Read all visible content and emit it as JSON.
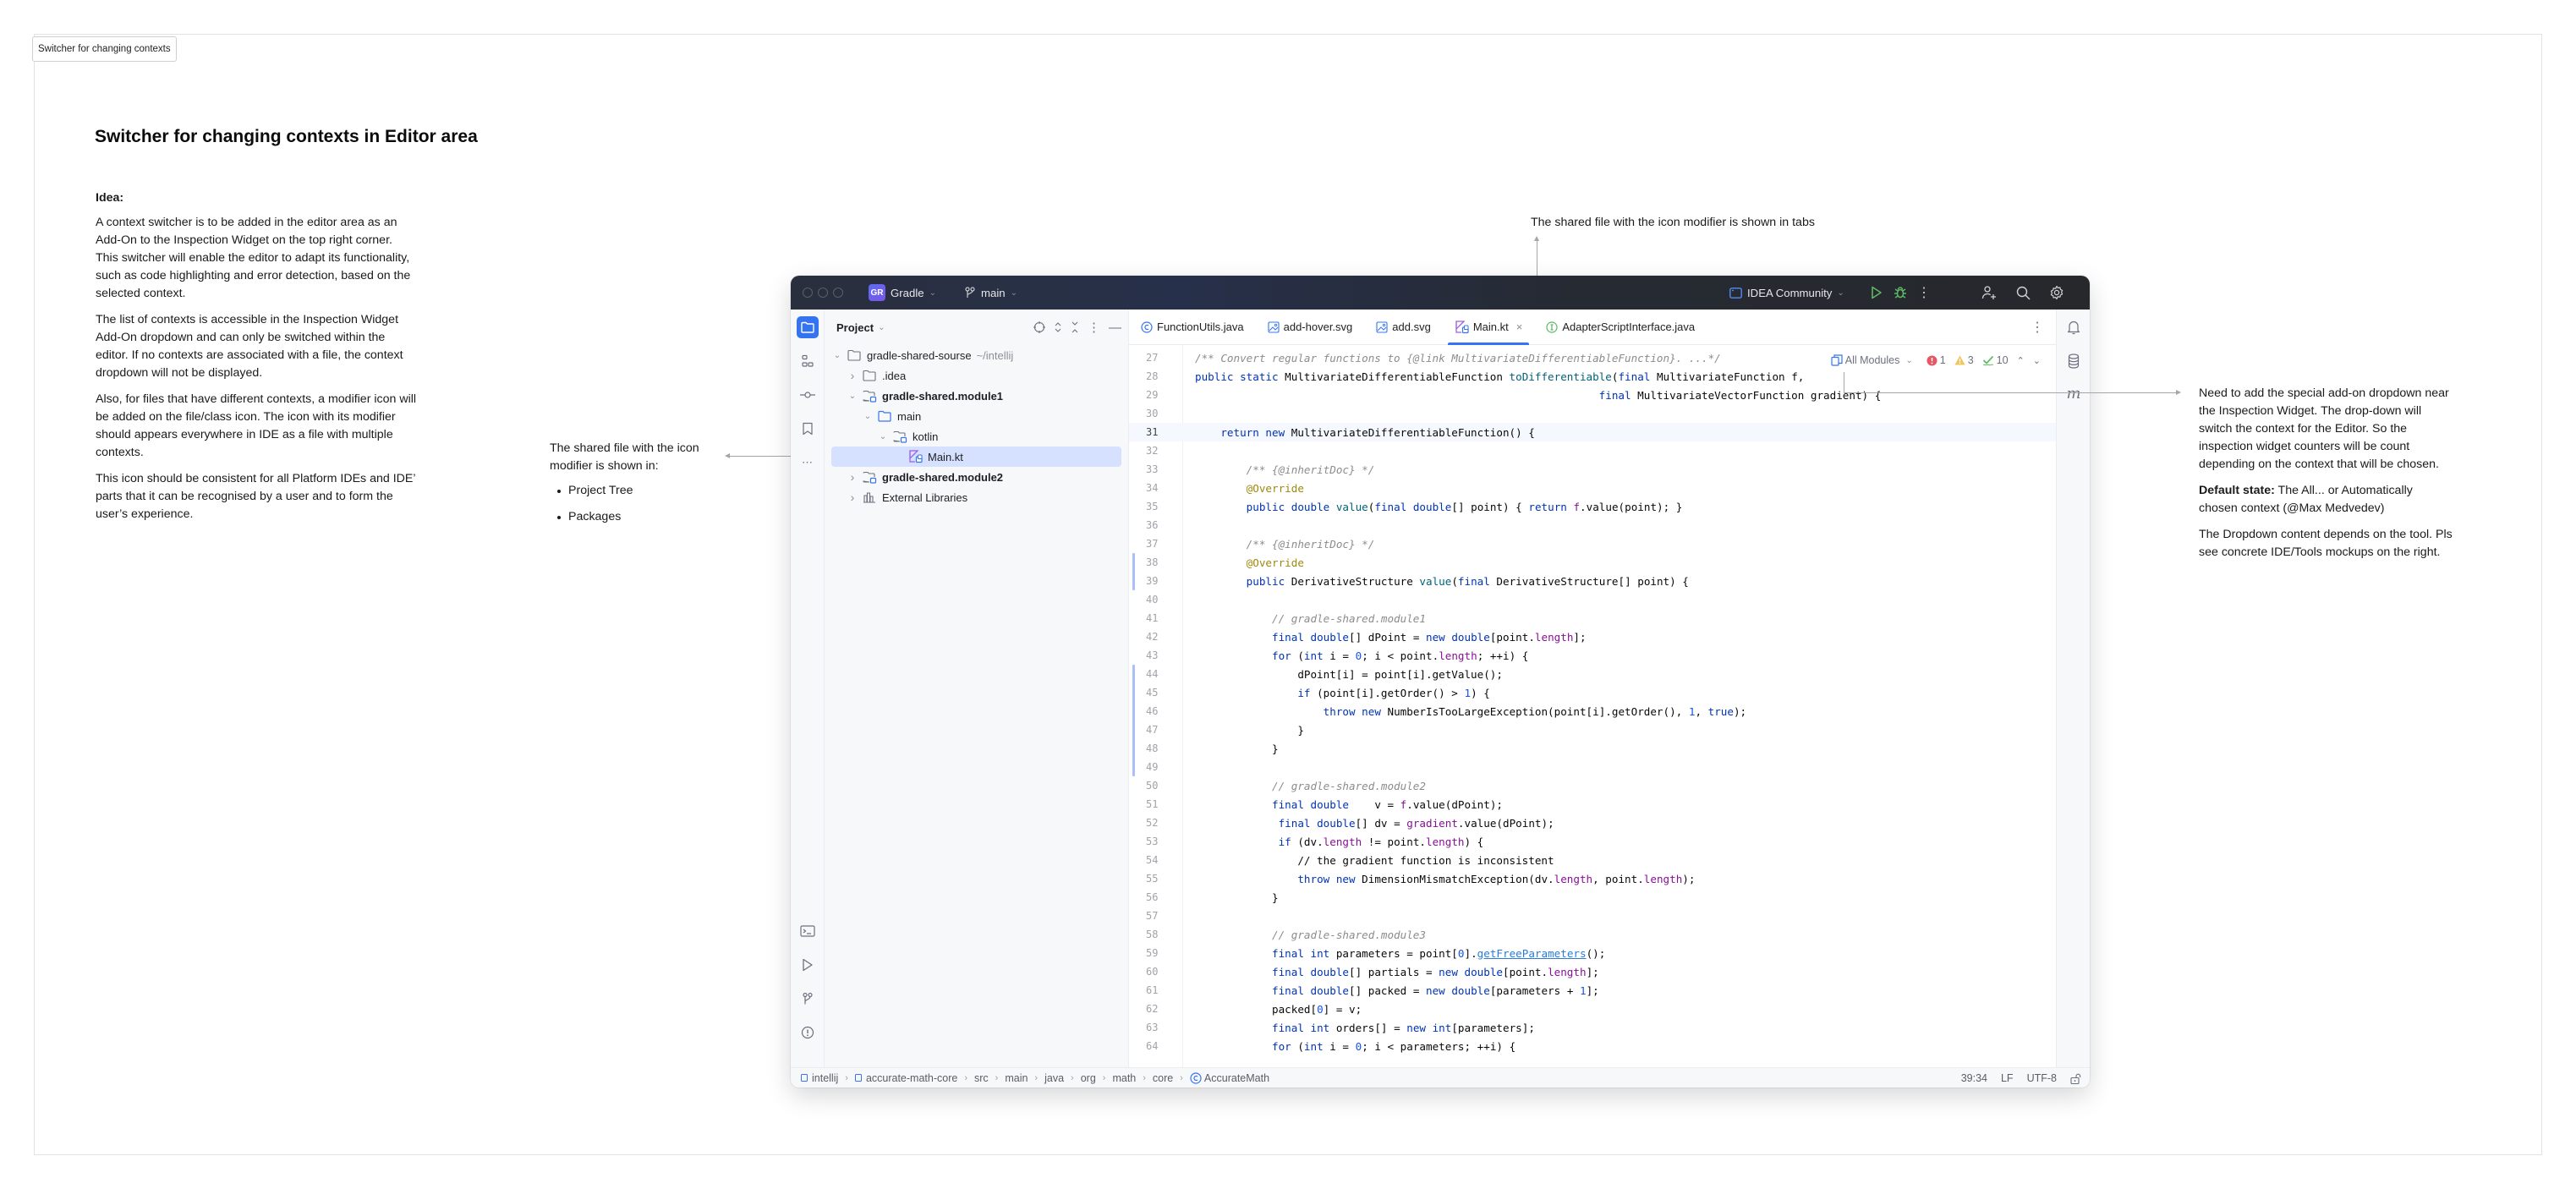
{
  "frame": {
    "label": "Switcher for changing contexts"
  },
  "page": {
    "title": "Switcher for changing contexts in Editor area"
  },
  "idea": {
    "heading": "Idea:",
    "paragraphs": [
      "A context switcher is to be added in the editor area as an Add-On to the Inspection Widget on the top right corner. This switcher will enable the editor to adapt its functionality, such as code highlighting and error detection, based on the selected context.",
      "The list of contexts is accessible in the Inspection Widget Add-On dropdown and can only be switched within the editor. If no contexts are associated with a file, the context dropdown will not be displayed.",
      "Also, for files that have different contexts, a modifier icon will be added on the file/class icon. The icon with its modifier should appears everywhere in IDE as a file with multiple contexts.",
      "This icon should be consistent for all Platform IDEs and IDE’ parts that it can be recognised by a user and to form the user’s experience."
    ]
  },
  "annotations": {
    "tree_note": {
      "text": "The shared file with the icon modifier is shown in:",
      "items": [
        "Project Tree",
        "Packages"
      ]
    },
    "tabs_note": "The shared file with the icon modifier is shown in tabs",
    "right_note": {
      "p1": "Need to add the special add-on dropdown near the Inspection Widget. The drop-down will switch the context for the Editor. So the inspection widget counters will be count depending on the context that will be chosen.",
      "default_label": "Default state:",
      "default_text": " The All...  or Automatically chosen context (@Max Medvedev)",
      "p3": "The Dropdown content depends on the tool. Pls see concrete IDE/Tools mockups on the right."
    }
  },
  "ide": {
    "titlebar": {
      "project_badge": "GR",
      "project_name": "Gradle",
      "branch": "main",
      "run_config": "IDEA Community"
    },
    "project_panel": {
      "title": "Project",
      "tree": [
        {
          "label": "gradle-shared-sourse",
          "suffix": "~/intellij",
          "level": 0,
          "expanded": true,
          "icon": "folder-icon",
          "bold": false
        },
        {
          "label": ".idea",
          "level": 1,
          "expanded": false,
          "icon": "folder-icon",
          "bold": false
        },
        {
          "label": "gradle-shared.module1",
          "level": 1,
          "expanded": true,
          "icon": "module-folder-icon",
          "bold": true
        },
        {
          "label": "main",
          "level": 2,
          "expanded": true,
          "icon": "source-folder-icon",
          "bold": false
        },
        {
          "label": "kotlin",
          "level": 3,
          "expanded": true,
          "icon": "module-folder-icon",
          "bold": false
        },
        {
          "label": "Main.kt",
          "level": 4,
          "icon": "kotlin-shared-file-icon",
          "bold": false,
          "selected": true
        },
        {
          "label": "gradle-shared.module2",
          "level": 1,
          "expanded": false,
          "icon": "module-folder-icon",
          "bold": true
        },
        {
          "label": "External Libraries",
          "level": 1,
          "expanded": false,
          "icon": "libraries-icon",
          "bold": false
        }
      ]
    },
    "tabs": [
      {
        "label": "FunctionUtils.java",
        "icon": "class-icon",
        "active": false
      },
      {
        "label": "add-hover.svg",
        "icon": "image-icon",
        "active": false
      },
      {
        "label": "add.svg",
        "icon": "image-icon",
        "active": false
      },
      {
        "label": "Main.kt",
        "icon": "kotlin-shared-file-icon",
        "active": true
      },
      {
        "label": "AdapterScriptInterface.java",
        "icon": "interface-icon",
        "active": false
      }
    ],
    "inspection_widget": {
      "context_dropdown": "All Modules",
      "errors": "1",
      "warnings": "3",
      "weak_warnings": "10"
    },
    "code": {
      "current_line": 31,
      "lines": [
        {
          "n": "27",
          "html": "<span class=\"cm\">/** Convert regular functions to {@link MultivariateDifferentiableFunction}. ...*/</span>"
        },
        {
          "n": "28",
          "html": "<span class=\"kw\">public static</span> MultivariateDifferentiableFunction <span class=\"fn\">toDifferentiable</span>(<span class=\"kw\">final</span> MultivariateFunction f,"
        },
        {
          "n": "29",
          "html": "                                                               <span class=\"kw\">final</span> MultivariateVectorFunction gradient) {"
        },
        {
          "n": "30",
          "html": ""
        },
        {
          "n": "31",
          "html": "    <span class=\"kw\">return new</span> MultivariateDifferentiableFunction() {"
        },
        {
          "n": "32",
          "html": ""
        },
        {
          "n": "33",
          "html": "        <span class=\"cm\">/** {@inheritDoc} */</span>"
        },
        {
          "n": "34",
          "html": "        <span class=\"an\">@Override</span>"
        },
        {
          "n": "35",
          "html": "        <span class=\"kw\">public double</span> <span class=\"fn\">value</span>(<span class=\"kw\">final double</span>[] point) { <span class=\"kw\">return</span> <span class=\"fld\">f</span>.value(point); }"
        },
        {
          "n": "36",
          "html": ""
        },
        {
          "n": "37",
          "html": "        <span class=\"cm\">/** {@inheritDoc} */</span>"
        },
        {
          "n": "38",
          "html": "        <span class=\"an\">@Override</span>"
        },
        {
          "n": "39",
          "html": "        <span class=\"kw\">public</span> DerivativeStructure <span class=\"fn\">value</span>(<span class=\"kw\">final</span> DerivativeStructure[] point) {"
        },
        {
          "n": "40",
          "html": ""
        },
        {
          "n": "41",
          "html": "            <span class=\"cm\">// gradle-shared.module1</span>"
        },
        {
          "n": "42",
          "html": "            <span class=\"kw\">final double</span>[] dPoint = <span class=\"kw\">new double</span>[point.<span class=\"fld\">length</span>];"
        },
        {
          "n": "43",
          "html": "            <span class=\"kw\">for</span> (<span class=\"kw\">int</span> i = <span class=\"num\">0</span>; i &lt; point.<span class=\"fld\">length</span>; ++i) {"
        },
        {
          "n": "44",
          "html": "                dPoint[i] = point[i].getValue();"
        },
        {
          "n": "45",
          "html": "                <span class=\"kw\">if</span> (point[i].getOrder() &gt; <span class=\"num\">1</span>) {"
        },
        {
          "n": "46",
          "html": "                    <span class=\"kw\">throw new</span> NumberIsTooLargeException(point[i].getOrder(), <span class=\"num\">1</span>, <span class=\"kw\">true</span>);"
        },
        {
          "n": "47",
          "html": "                }"
        },
        {
          "n": "48",
          "html": "            }"
        },
        {
          "n": "49",
          "html": ""
        },
        {
          "n": "50",
          "html": "            <span class=\"cm\">// gradle-shared.module2</span>"
        },
        {
          "n": "51",
          "html": "            <span class=\"kw\">final double</span>    v = <span class=\"fld\">f</span>.value(dPoint);"
        },
        {
          "n": "52",
          "html": "             <span class=\"kw\">final double</span>[] dv = <span class=\"fld\">gradient</span>.value(dPoint);"
        },
        {
          "n": "53",
          "html": "             <span class=\"kw\">if</span> (dv.<span class=\"fld\">length</span> != point.<span class=\"fld\">length</span>) {"
        },
        {
          "n": "54",
          "html": "                // the gradient function is inconsistent"
        },
        {
          "n": "55",
          "html": "                <span class=\"kw\">throw new</span> DimensionMismatchException(dv.<span class=\"fld\">length</span>, point.<span class=\"fld\">length</span>);"
        },
        {
          "n": "56",
          "html": "            }"
        },
        {
          "n": "57",
          "html": ""
        },
        {
          "n": "58",
          "html": "            <span class=\"cm\">// gradle-shared.module3</span>"
        },
        {
          "n": "59",
          "html": "            <span class=\"kw\">final int</span> parameters = point[<span class=\"num\">0</span>].<span class=\"link\">getFreeParameters</span>();"
        },
        {
          "n": "60",
          "html": "            <span class=\"kw\">final double</span>[] partials = <span class=\"kw\">new double</span>[point.<span class=\"fld\">length</span>];"
        },
        {
          "n": "61",
          "html": "            <span class=\"kw\">final double</span>[] packed = <span class=\"kw\">new double</span>[parameters + <span class=\"num\">1</span>];"
        },
        {
          "n": "62",
          "html": "            packed[<span class=\"num\">0</span>] = v;"
        },
        {
          "n": "63",
          "html": "            <span class=\"kw\">final int</span> orders[] = <span class=\"kw\">new int</span>[parameters];"
        },
        {
          "n": "64",
          "html": "            <span class=\"kw\">for</span> (<span class=\"kw\">int</span> i = <span class=\"num\">0</span>; i &lt; parameters; ++i) {"
        }
      ]
    },
    "breadcrumbs": [
      "intellij",
      "accurate-math-core",
      "src",
      "main",
      "java",
      "org",
      "math",
      "core",
      "AccurateMath"
    ],
    "status": {
      "position": "39:34",
      "line_separator": "LF",
      "encoding": "UTF-8"
    }
  },
  "colors": {
    "accent": "#3574f0",
    "selection": "#d5e1ff",
    "error": "#e55765",
    "warning": "#f2c55c",
    "ok": "#5fb865",
    "run": "#5fb865"
  }
}
